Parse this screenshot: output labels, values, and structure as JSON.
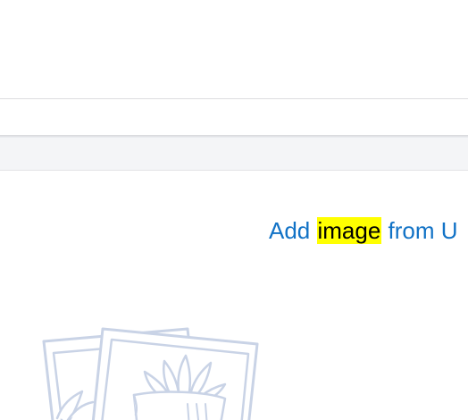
{
  "link": {
    "prefix": "Add ",
    "highlight": "image",
    "suffix": " from U"
  },
  "colors": {
    "link": "#1172c6",
    "highlight": "#ffff00",
    "toolbar_bg": "#f4f5f7",
    "illustration_stroke": "#c9d3e6"
  },
  "illustration": {
    "icon": "photo-placeholder-icon"
  }
}
